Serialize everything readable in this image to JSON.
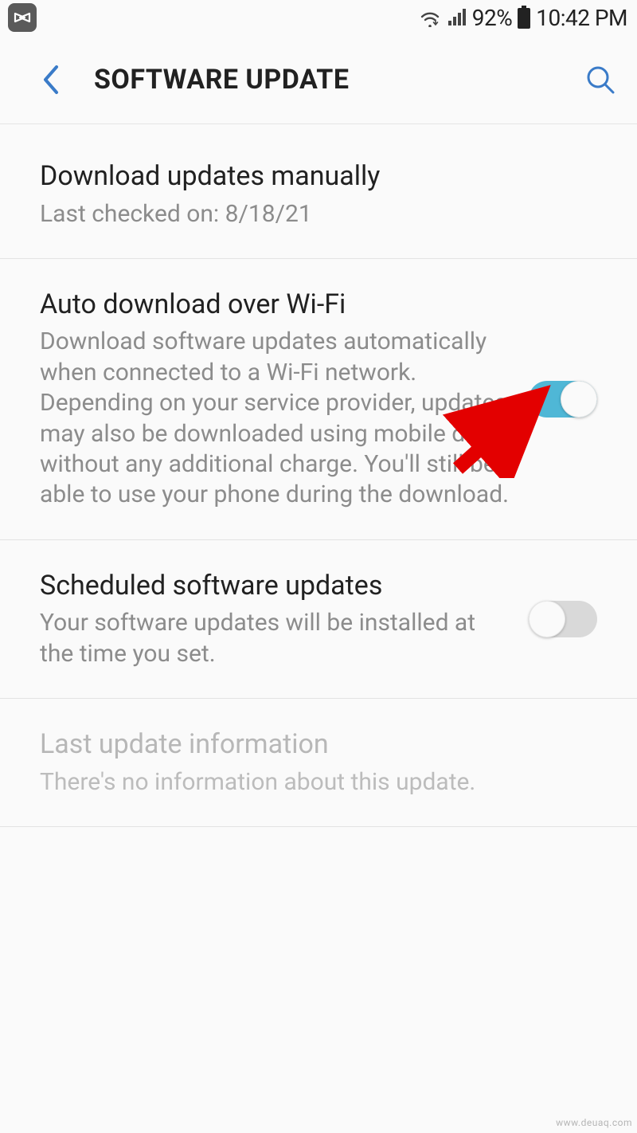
{
  "status": {
    "battery_pct": "92%",
    "time": "10:42 PM"
  },
  "header": {
    "title": "SOFTWARE UPDATE"
  },
  "items": [
    {
      "title": "Download updates manually",
      "sub": "Last checked on: 8/18/21"
    },
    {
      "title": "Auto download over Wi-Fi",
      "sub": "Download software updates automatically when connected to a Wi-Fi network. Depending on your service provider, updates may also be downloaded using mobile data without any additional charge. You'll still be able to use your phone during the download."
    },
    {
      "title": "Scheduled software updates",
      "sub": "Your software updates will be installed at the time you set."
    },
    {
      "title": "Last update information",
      "sub": "There's no information about this update."
    }
  ],
  "watermark": "www.deuaq.com"
}
